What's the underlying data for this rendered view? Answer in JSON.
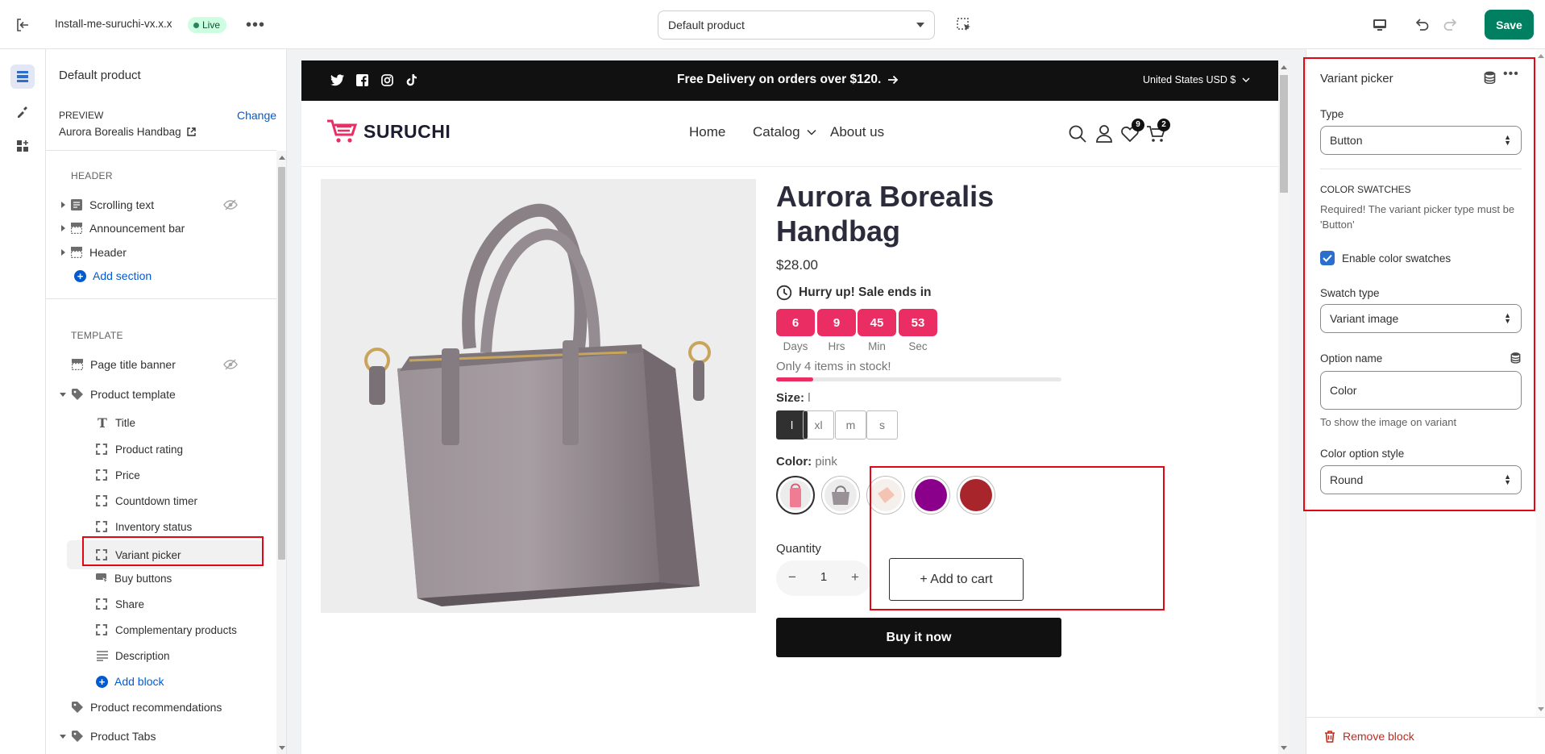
{
  "topbar": {
    "store_name": "Install-me-suruchi-vx.x.x",
    "live_badge": "Live",
    "template_select": "Default product",
    "save_label": "Save"
  },
  "left_panel": {
    "title": "Default product",
    "preview_label": "PREVIEW",
    "change_label": "Change",
    "preview_product": "Aurora Borealis Handbag",
    "header_section_label": "HEADER",
    "header_items": [
      "Scrolling text",
      "Announcement bar",
      "Header"
    ],
    "add_section_label": "Add section",
    "template_section_label": "TEMPLATE",
    "page_title_banner": "Page title banner",
    "product_template": "Product template",
    "blocks": [
      "Title",
      "Product rating",
      "Price",
      "Countdown timer",
      "Inventory status",
      "Variant picker",
      "Buy buttons",
      "Share",
      "Complementary products",
      "Description"
    ],
    "add_block_label": "Add block",
    "product_recommendations": "Product recommendations",
    "product_tabs": "Product Tabs"
  },
  "storefront": {
    "announcement": "Free Delivery on orders over $120.",
    "currency": "United States USD $",
    "logo_text": "SURUCHI",
    "nav": [
      "Home",
      "Catalog",
      "About us"
    ],
    "wishlist_count": "9",
    "cart_count": "2",
    "product_title_line1": "Aurora Borealis",
    "product_title_line2": "Handbag",
    "price": "$28.00",
    "countdown_heading": "Hurry up! Sale ends in",
    "countdown": [
      {
        "value": "6",
        "unit": "Days"
      },
      {
        "value": "9",
        "unit": "Hrs"
      },
      {
        "value": "45",
        "unit": "Min"
      },
      {
        "value": "53",
        "unit": "Sec"
      }
    ],
    "stock_text": "Only 4 items in stock!",
    "stock_progress_fraction": 0.13,
    "size_label": "Size:",
    "size_selected": "l",
    "sizes": [
      "l",
      "xl",
      "m",
      "s"
    ],
    "color_label": "Color:",
    "color_selected": "pink",
    "color_swatches": [
      "pink",
      "grey",
      "peach",
      "#8b008b",
      "#a8262b"
    ],
    "quantity_label": "Quantity",
    "quantity_value": "1",
    "quantity_minus": "−",
    "quantity_plus": "+",
    "add_to_cart": "+ Add to cart",
    "buy_now": "Buy it now"
  },
  "right_panel": {
    "title": "Variant picker",
    "type_label": "Type",
    "type_value": "Button",
    "color_swatches_heading": "COLOR SWATCHES",
    "color_swatches_help": "Required! The variant picker type must be 'Button'",
    "enable_swatches_label": "Enable color swatches",
    "enable_swatches_checked": true,
    "swatch_type_label": "Swatch type",
    "swatch_type_value": "Variant image",
    "option_name_label": "Option name",
    "option_name_value": "Color",
    "option_name_help": "To show the image on variant",
    "color_option_style_label": "Color option style",
    "color_option_style_value": "Round",
    "remove_block_label": "Remove block"
  },
  "colors": {
    "accent_pink": "#ea2e64",
    "save_green": "#008060",
    "highlight_red": "#e30613",
    "link_blue": "#005bd3"
  }
}
